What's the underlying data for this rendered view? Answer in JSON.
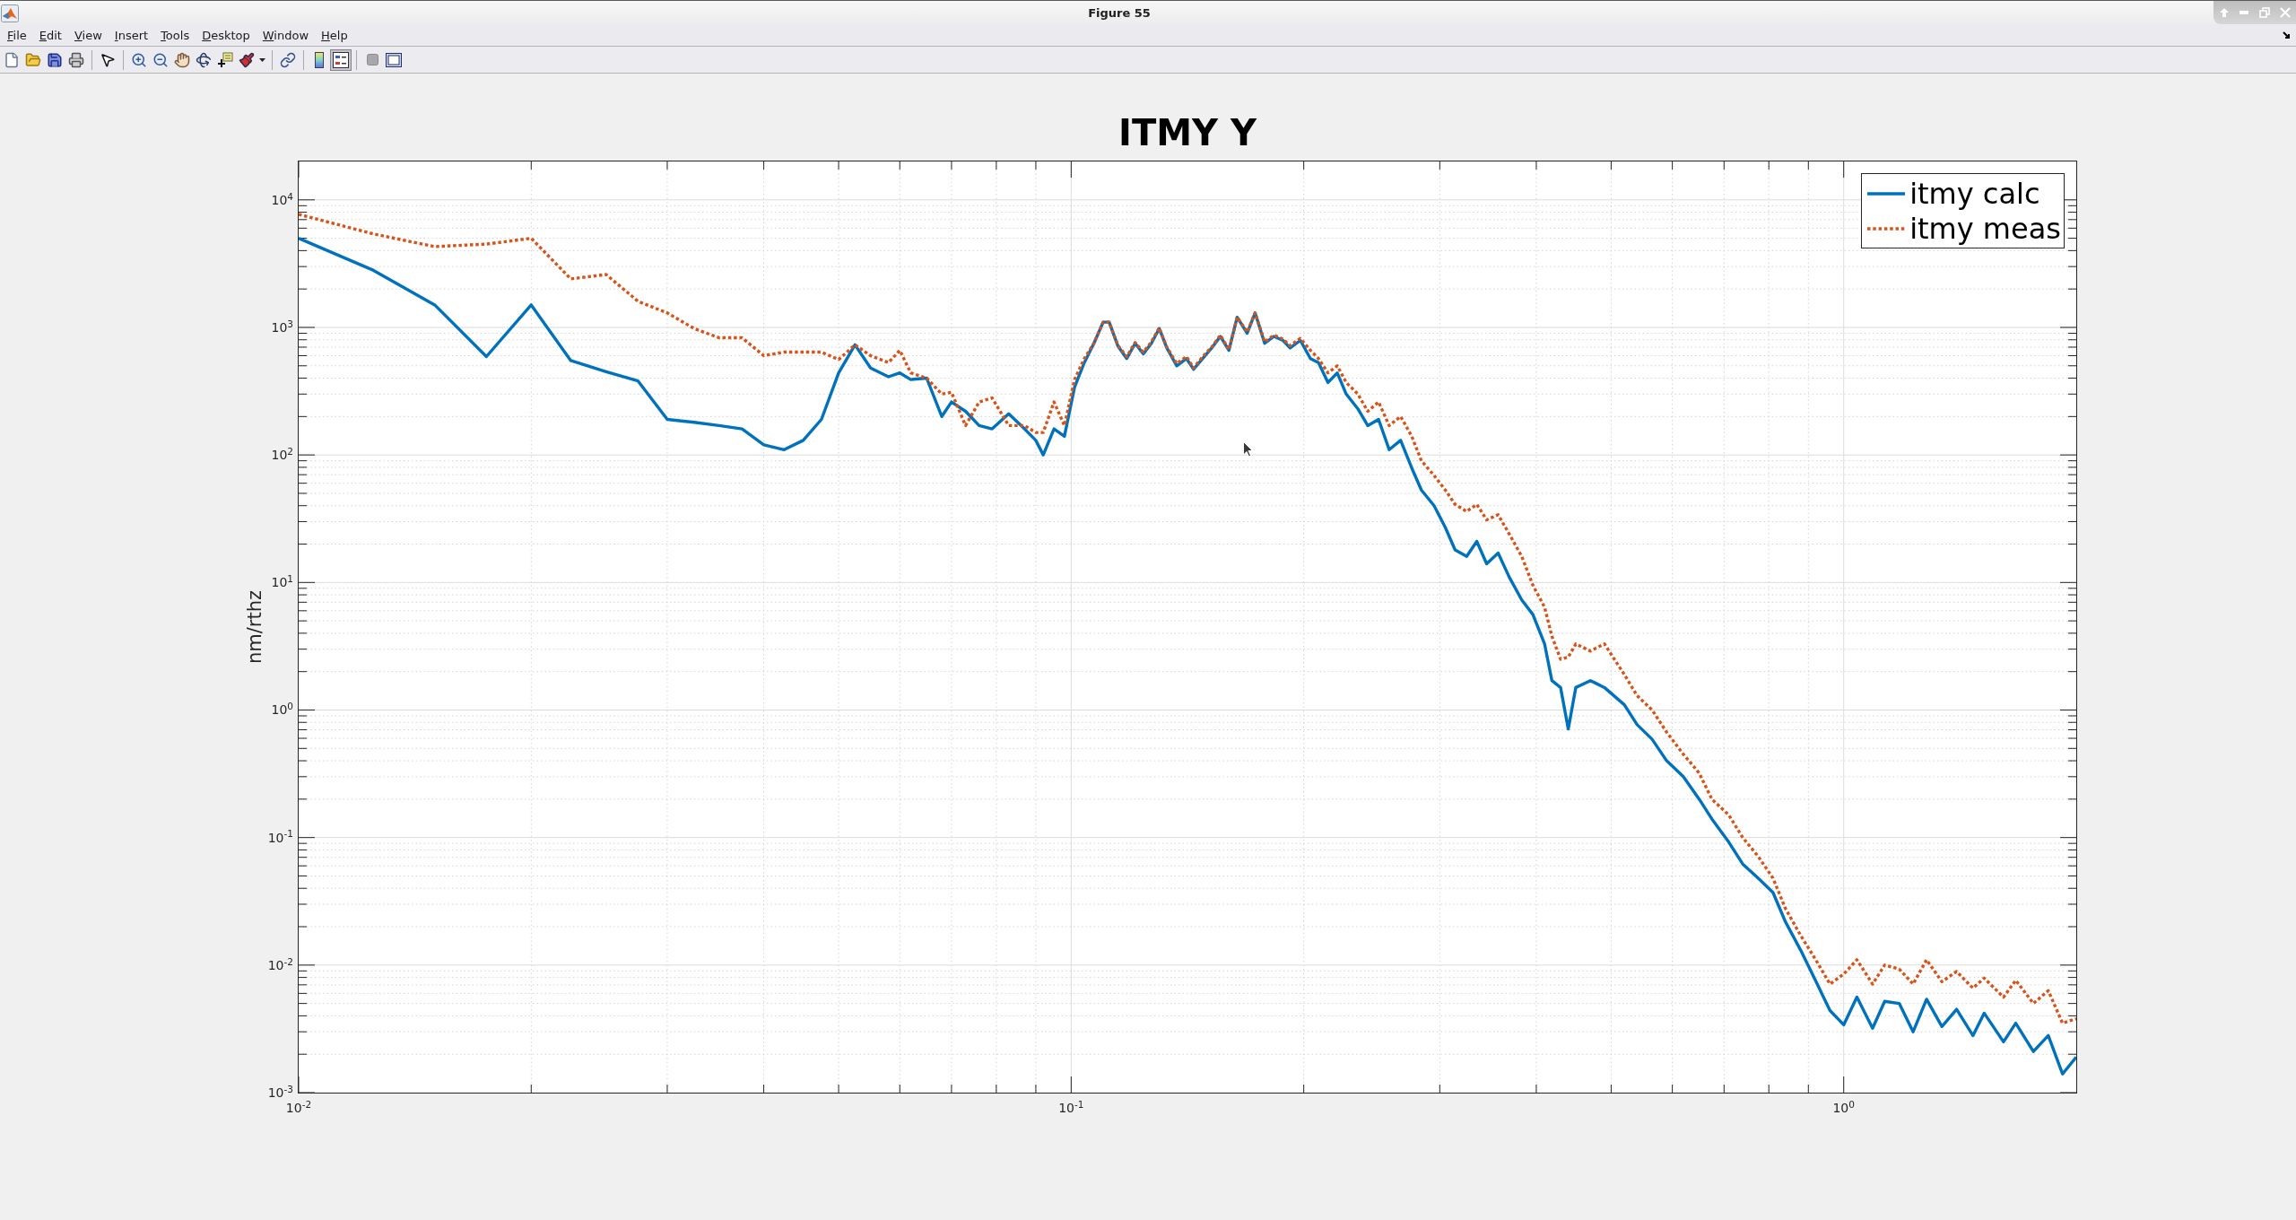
{
  "window": {
    "title": "Figure 55"
  },
  "menu": [
    "File",
    "Edit",
    "View",
    "Insert",
    "Tools",
    "Desktop",
    "Window",
    "Help"
  ],
  "toolbar_toggles": [
    {
      "on": false
    },
    {
      "on": true
    }
  ],
  "figure": {
    "chart_data": {
      "type": "line",
      "title": "ITMY Y",
      "ylabel": "nm/rthz",
      "log": "xy",
      "grid": true,
      "legend": "upper right",
      "x": [
        0.01,
        0.0125,
        0.015,
        0.0175,
        0.02,
        0.0225,
        0.025,
        0.0275,
        0.03,
        0.0325,
        0.035,
        0.0375,
        0.04,
        0.0425,
        0.045,
        0.0475,
        0.05,
        0.0525,
        0.055,
        0.058,
        0.06,
        0.062,
        0.065,
        0.068,
        0.07,
        0.073,
        0.076,
        0.079,
        0.083,
        0.087,
        0.09,
        0.092,
        0.095,
        0.098,
        0.101,
        0.104,
        0.107,
        0.11,
        0.112,
        0.115,
        0.118,
        0.121,
        0.124,
        0.127,
        0.13,
        0.133,
        0.137,
        0.141,
        0.144,
        0.148,
        0.152,
        0.156,
        0.16,
        0.164,
        0.169,
        0.173,
        0.178,
        0.183,
        0.188,
        0.192,
        0.198,
        0.204,
        0.209,
        0.215,
        0.221,
        0.227,
        0.235,
        0.242,
        0.25,
        0.258,
        0.267,
        0.276,
        0.284,
        0.295,
        0.305,
        0.314,
        0.325,
        0.335,
        0.345,
        0.357,
        0.369,
        0.383,
        0.396,
        0.41,
        0.419,
        0.43,
        0.44,
        0.45,
        0.47,
        0.49,
        0.52,
        0.54,
        0.565,
        0.59,
        0.62,
        0.65,
        0.675,
        0.71,
        0.74,
        0.775,
        0.81,
        0.84,
        0.88,
        0.92,
        0.96,
        1.0,
        1.04,
        1.09,
        1.13,
        1.18,
        1.23,
        1.28,
        1.34,
        1.4,
        1.47,
        1.52,
        1.61,
        1.67,
        1.76,
        1.84,
        1.92,
        2.0
      ],
      "series": [
        {
          "name": "itmy calc",
          "color": "#0072bd",
          "line_style": "solid",
          "values": [
            5000,
            2800,
            1500,
            590,
            1500,
            550,
            450,
            380,
            190,
            180,
            170,
            160,
            120,
            110,
            130,
            190,
            440,
            730,
            480,
            410,
            440,
            390,
            400,
            200,
            260,
            220,
            170,
            160,
            210,
            160,
            130,
            100,
            160,
            140,
            340,
            530,
            750,
            1100,
            1100,
            710,
            570,
            750,
            620,
            750,
            980,
            690,
            500,
            570,
            470,
            570,
            690,
            850,
            660,
            1200,
            900,
            1300,
            750,
            850,
            790,
            690,
            790,
            570,
            530,
            370,
            440,
            300,
            230,
            170,
            190,
            110,
            130,
            79,
            53,
            40,
            27,
            18,
            16,
            21,
            14,
            17,
            11,
            7.3,
            5.6,
            3.3,
            1.7,
            1.5,
            0.71,
            1.5,
            1.7,
            1.5,
            1.1,
            0.77,
            0.59,
            0.4,
            0.3,
            0.2,
            0.14,
            0.092,
            0.062,
            0.048,
            0.037,
            0.022,
            0.013,
            0.0075,
            0.0044,
            0.0034,
            0.0056,
            0.0032,
            0.0052,
            0.005,
            0.003,
            0.0054,
            0.0033,
            0.0045,
            0.0028,
            0.0042,
            0.0025,
            0.0035,
            0.0021,
            0.0028,
            0.0014,
            0.0019
          ]
        },
        {
          "name": "itmy meas",
          "color": "#d95319",
          "line_style": "dotted",
          "values": [
            7700,
            5400,
            4300,
            4500,
            5000,
            2400,
            2600,
            1600,
            1300,
            980,
            830,
            830,
            600,
            640,
            640,
            640,
            560,
            730,
            600,
            530,
            660,
            440,
            400,
            300,
            310,
            170,
            260,
            280,
            170,
            170,
            150,
            150,
            260,
            170,
            390,
            570,
            750,
            1100,
            1100,
            720,
            590,
            760,
            640,
            770,
            990,
            700,
            520,
            590,
            480,
            590,
            700,
            870,
            670,
            1200,
            920,
            1300,
            770,
            870,
            810,
            720,
            820,
            660,
            570,
            440,
            500,
            370,
            300,
            220,
            260,
            170,
            200,
            140,
            90,
            69,
            53,
            41,
            36,
            41,
            31,
            34,
            24,
            16,
            9.5,
            6.4,
            3.8,
            2.5,
            2.6,
            3.3,
            2.9,
            3.3,
            1.9,
            1.3,
            1.0,
            0.67,
            0.45,
            0.32,
            0.2,
            0.15,
            0.1,
            0.071,
            0.048,
            0.028,
            0.017,
            0.011,
            0.0071,
            0.0085,
            0.011,
            0.0071,
            0.01,
            0.0093,
            0.0071,
            0.011,
            0.0074,
            0.0089,
            0.0066,
            0.0079,
            0.0056,
            0.0076,
            0.005,
            0.0063,
            0.0035,
            0.0038
          ]
        }
      ],
      "xlim": [
        0.01,
        2
      ],
      "ylim": [
        0.001,
        20000
      ],
      "xticks": [
        {
          "value": 0.01,
          "label": "10$^{-2}$"
        },
        {
          "value": 0.1,
          "label": "10$^{-1}$"
        },
        {
          "value": 1,
          "label": "10$^{0}$"
        }
      ],
      "yticks": [
        {
          "value": 0.001,
          "label": "10$^{-3}$"
        },
        {
          "value": 0.01,
          "label": "10$^{-2}$"
        },
        {
          "value": 0.1,
          "label": "10$^{-1}$"
        },
        {
          "value": 1,
          "label": "10$^{0}$"
        },
        {
          "value": 10,
          "label": "10$^{1}$"
        },
        {
          "value": 100,
          "label": "10$^{2}$"
        },
        {
          "value": 1000,
          "label": "10$^{3}$"
        },
        {
          "value": 10000,
          "label": "10$^{4}$"
        }
      ]
    }
  }
}
